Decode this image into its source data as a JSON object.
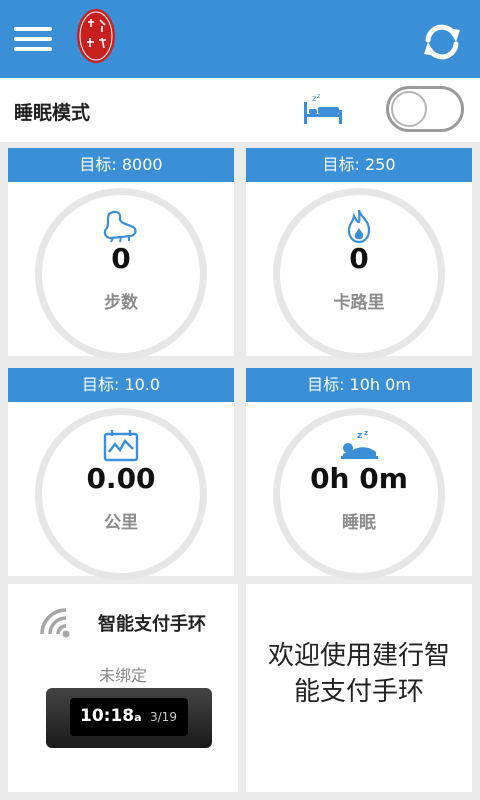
{
  "header": {
    "menu_icon": "hamburger-menu-icon",
    "logo_icon": "red-seal-logo",
    "logo_text": "華龍原騰",
    "refresh_icon": "sync-refresh-icon",
    "accent_color": "#3a8fd7"
  },
  "sleep_mode": {
    "label": "睡眠模式",
    "icon": "bed-sleep-icon",
    "enabled": false
  },
  "cards": [
    {
      "goal": "目标: 8000",
      "value": "0",
      "label": "步数",
      "icon": "shoe-steps-icon"
    },
    {
      "goal": "目标: 250",
      "value": "0",
      "label": "卡路里",
      "icon": "flame-calorie-icon"
    },
    {
      "goal": "目标: 10.0",
      "value": "0.00",
      "label": "公里",
      "icon": "distance-monitor-icon"
    },
    {
      "goal": "目标: 10h 0m",
      "value": "0h 0m",
      "label": "睡眠",
      "icon": "sleeping-person-icon"
    }
  ],
  "band": {
    "icon": "wireless-signal-icon",
    "title": "智能支付手环",
    "status": "未绑定",
    "screen_time": "10:18",
    "screen_suffix": "a",
    "screen_date": "3/19"
  },
  "welcome": {
    "text": "欢迎使用建行智能支付手环"
  }
}
